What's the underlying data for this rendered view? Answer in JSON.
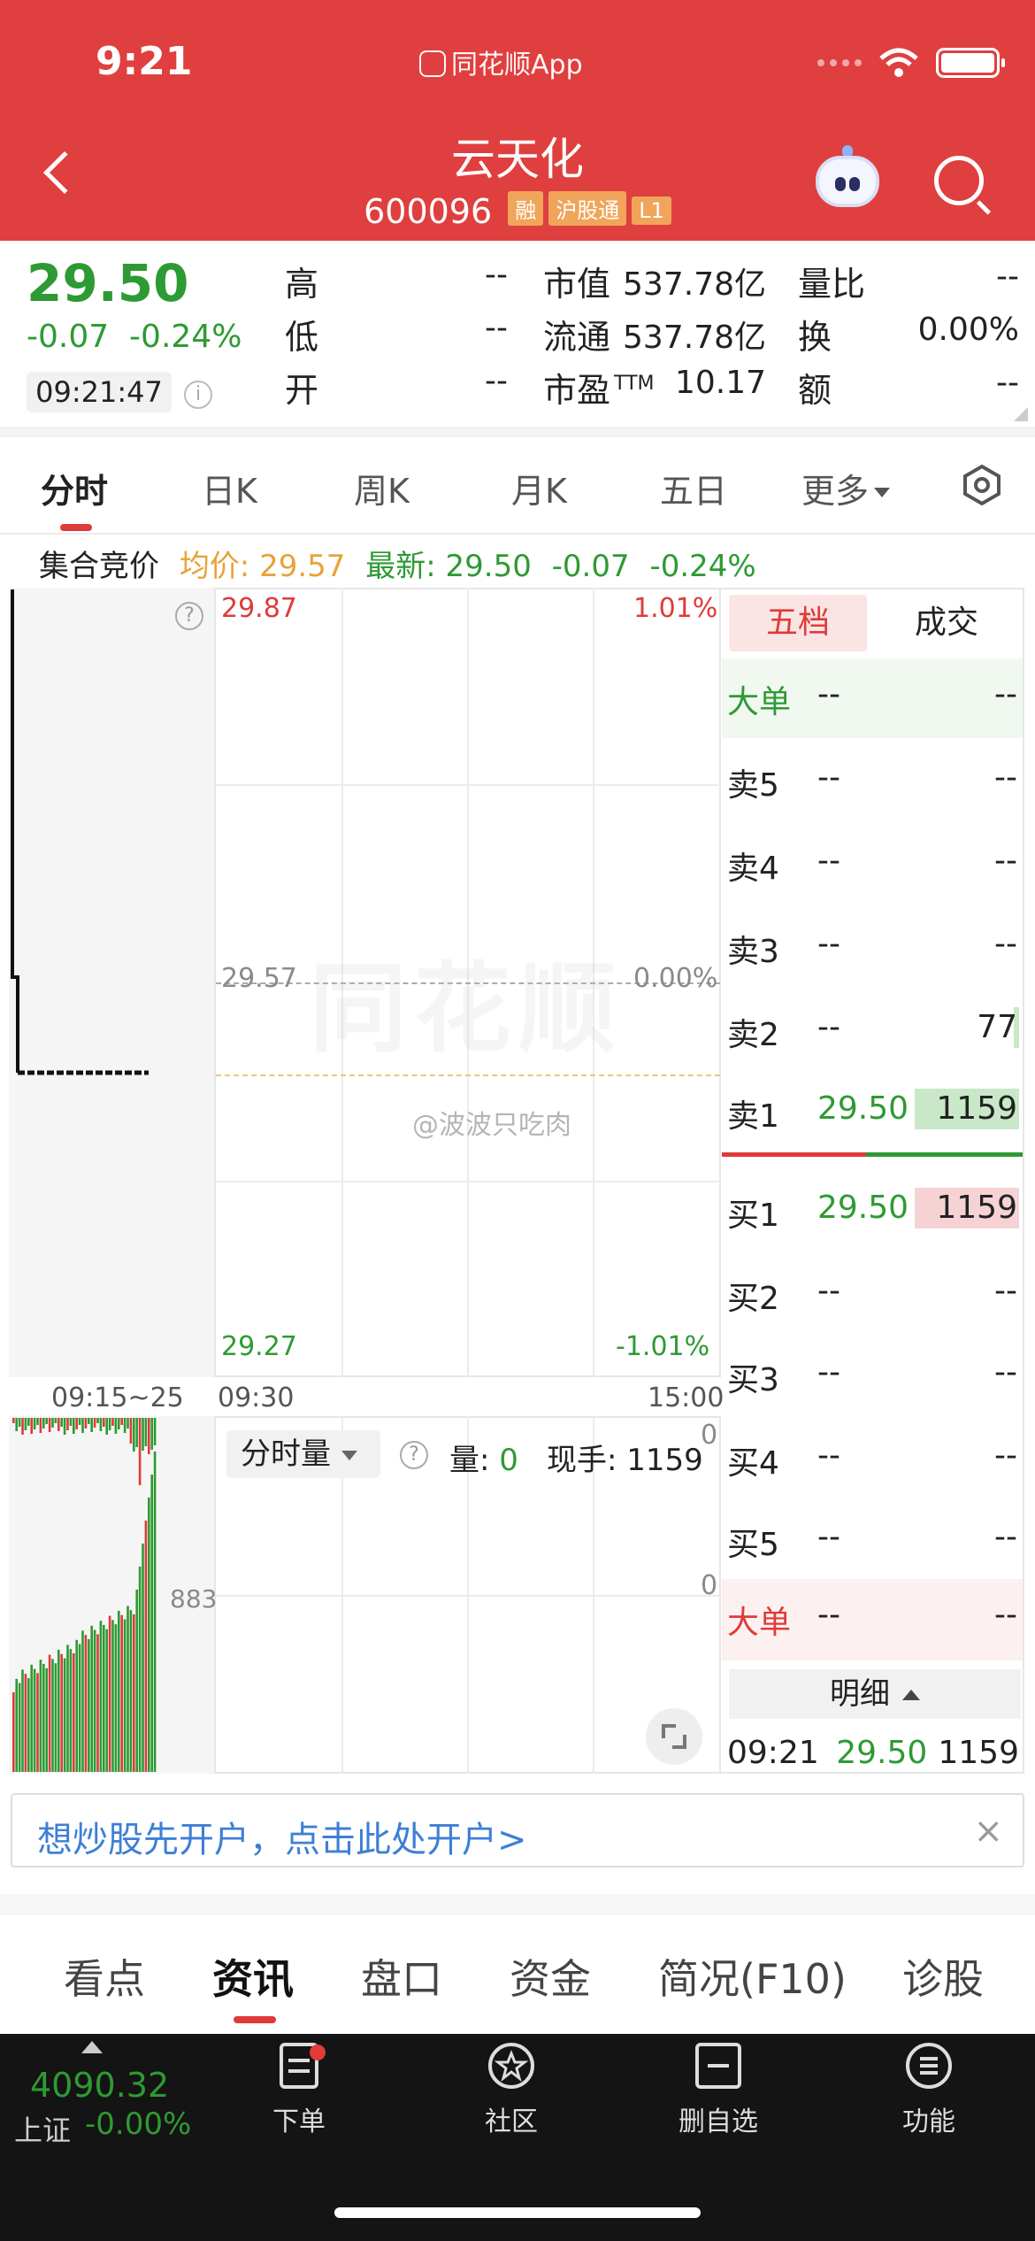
{
  "status": {
    "time": "9:21",
    "app_label": "同花顺App"
  },
  "header": {
    "title": "云天化",
    "code": "600096",
    "tags": [
      "融",
      "沪股通",
      "L1"
    ]
  },
  "quote": {
    "price": "29.50",
    "change": "-0.07",
    "change_pct": "-0.24%",
    "time": "09:21:47",
    "high_label": "高",
    "high": "--",
    "low_label": "低",
    "low": "--",
    "open_label": "开",
    "open": "--",
    "mcap_label": "市值",
    "mcap": "537.78亿",
    "float_label": "流通",
    "float": "537.78亿",
    "pe_label": "市盈",
    "pe_sup": "TTM",
    "pe": "10.17",
    "vr_label": "量比",
    "vr": "--",
    "turnover_label": "换",
    "turnover": "0.00%",
    "amount_label": "额",
    "amount": "--"
  },
  "ktabs": [
    "分时",
    "日K",
    "周K",
    "月K",
    "五日",
    "更多"
  ],
  "infobar": {
    "label": "集合竞价",
    "avg": "均价: 29.57",
    "latest": "最新: 29.50",
    "chg": "-0.07",
    "chg_pct": "-0.24%"
  },
  "chart": {
    "top_price": "29.87",
    "top_pct": "1.01%",
    "mid_price": "29.57",
    "mid_pct": "0.00%",
    "bottom_price": "29.27",
    "bottom_pct": "-1.01%",
    "time_start": "09:15~25",
    "time_open": "09:30",
    "time_close": "15:00",
    "watermark": "同花顺",
    "weibo": "@波波只吃肉"
  },
  "volume": {
    "selector": "分时量",
    "vol_label": "量:",
    "vol_value": "0",
    "now_label": "现手:",
    "now_value": "1159",
    "top_right": "0",
    "mid_right": "0",
    "left_axis": "883"
  },
  "book": {
    "tabs": [
      "五档",
      "成交"
    ],
    "big_buy": {
      "label": "大单",
      "price": "--",
      "vol": "--"
    },
    "sells": [
      {
        "label": "卖5",
        "price": "--",
        "vol": "--"
      },
      {
        "label": "卖4",
        "price": "--",
        "vol": "--"
      },
      {
        "label": "卖3",
        "price": "--",
        "vol": "--"
      },
      {
        "label": "卖2",
        "price": "--",
        "vol": "77"
      },
      {
        "label": "卖1",
        "price": "29.50",
        "vol": "1159"
      }
    ],
    "buys": [
      {
        "label": "买1",
        "price": "29.50",
        "vol": "1159"
      },
      {
        "label": "买2",
        "price": "--",
        "vol": "--"
      },
      {
        "label": "买3",
        "price": "--",
        "vol": "--"
      },
      {
        "label": "买4",
        "price": "--",
        "vol": "--"
      },
      {
        "label": "买5",
        "price": "--",
        "vol": "--"
      }
    ],
    "big_sell": {
      "label": "大单",
      "price": "--",
      "vol": "--"
    },
    "detail_label": "明细",
    "detail": {
      "time": "09:21",
      "price": "29.50",
      "vol": "1159"
    }
  },
  "ad": {
    "text": "想炒股先开户，点击此处开户>",
    "close": "×"
  },
  "bottom_tabs": [
    "看点",
    "资讯",
    "盘口",
    "资金",
    "简况(F10)",
    "诊股"
  ],
  "tabbar": {
    "index_value": "4090.32",
    "index_name": "上证",
    "index_chg": "-0.00%",
    "items": [
      "下单",
      "社区",
      "删自选",
      "功能"
    ]
  },
  "colors": {
    "header_red": "#e03f3f",
    "up_red": "#e03a3a",
    "down_green": "#2e9a33",
    "avg_orange": "#e8a23a"
  }
}
